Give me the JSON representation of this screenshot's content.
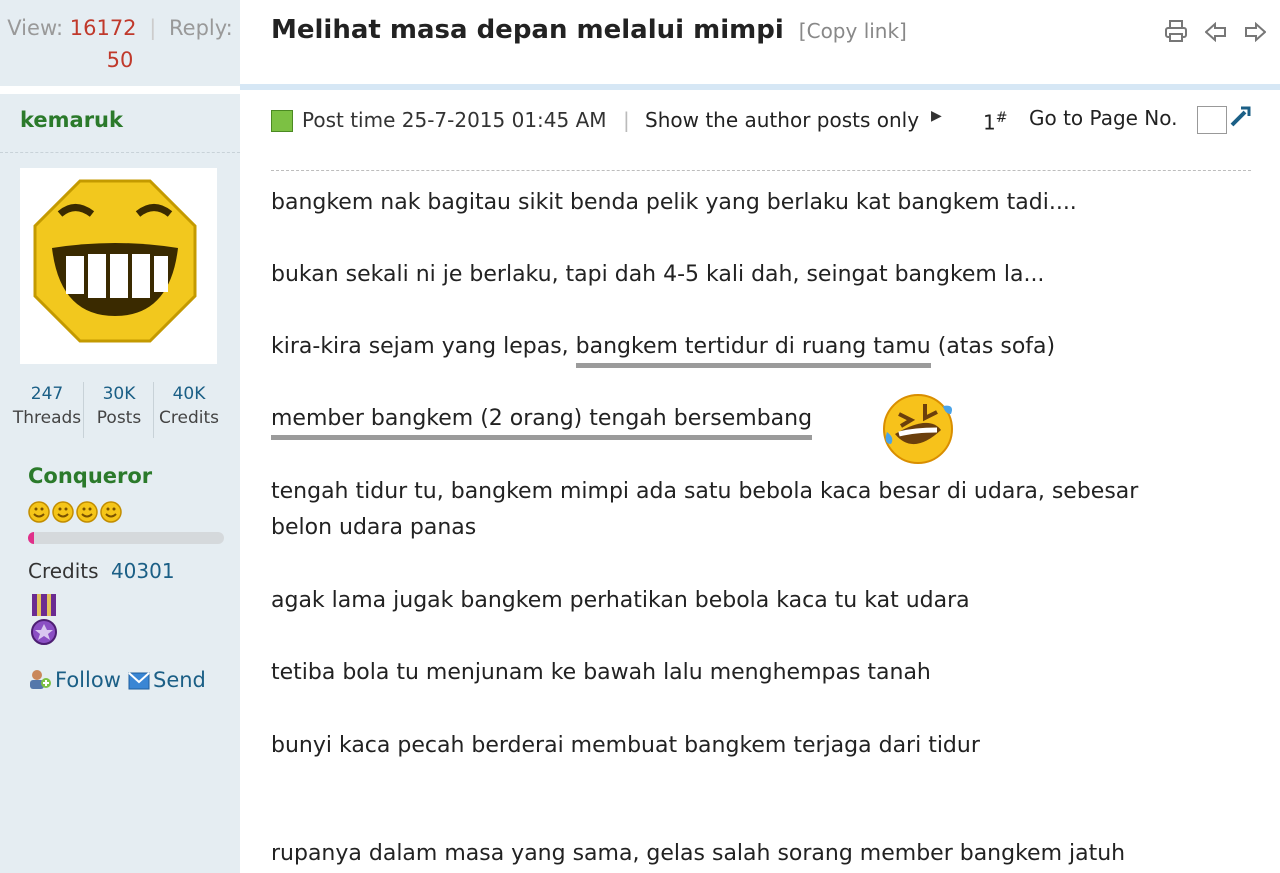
{
  "thread_stats": {
    "view_label": "View:",
    "view_count": "16172",
    "reply_label": "Reply:",
    "reply_count": "50"
  },
  "thread": {
    "title": "Melihat masa depan melalui mimpi",
    "copy_link": "[Copy link]",
    "toolbar_icons": [
      "print-icon",
      "previous-thread-icon",
      "next-thread-icon"
    ]
  },
  "author": {
    "name": "kemaruk",
    "avatar_icon": "laughing-smiley-avatar",
    "threads_value": "247",
    "threads_label": "Threads",
    "posts_value": "30K",
    "posts_label": "Posts",
    "credits_value": "40K",
    "credits_label": "Credits",
    "rank": "Conqueror",
    "rank_stars": 4,
    "rank_progress": 0.03,
    "credits_text_label": "Credits",
    "credits_text_value": "40301",
    "follow_label": "Follow",
    "send_label": "Send"
  },
  "post": {
    "post_time": "Post time 25-7-2015 01:45 AM",
    "show_author_only": "Show the author posts only",
    "floor": "1",
    "floor_mark": "#",
    "goto_page": "Go to Page No.",
    "lines": [
      "bangkem nak bagitau sikit benda pelik yang berlaku kat bangkem tadi....",
      "bukan sekali ni je berlaku, tapi dah 4-5 kali dah, seingat bangkem la...",
      "kira-kira sejam yang lepas, ",
      "bangkem tertidur di ruang tamu",
      " (atas sofa)",
      "member bangkem (2 orang) tengah bersembang",
      "tengah tidur tu, bangkem mimpi ada satu bebola kaca besar di udara, sebesar",
      "belon udara panas",
      "agak lama jugak bangkem perhatikan bebola kaca tu kat udara",
      "tetiba bola tu menjunam ke bawah lalu menghempas tanah",
      "bunyi kaca pecah berderai membuat bangkem terjaga dari tidur",
      "rupanya dalam masa yang sama, gelas salah sorang member bangkem jatuh"
    ],
    "emoji_icon": "rolling-on-floor-laughing-emoji"
  },
  "colors": {
    "sidebar_bg": "#e5edf2",
    "accent_green": "#2b7a2b",
    "link_blue": "#1b5f86",
    "count_red": "#c0392b",
    "progress_pink": "#e0308a"
  }
}
